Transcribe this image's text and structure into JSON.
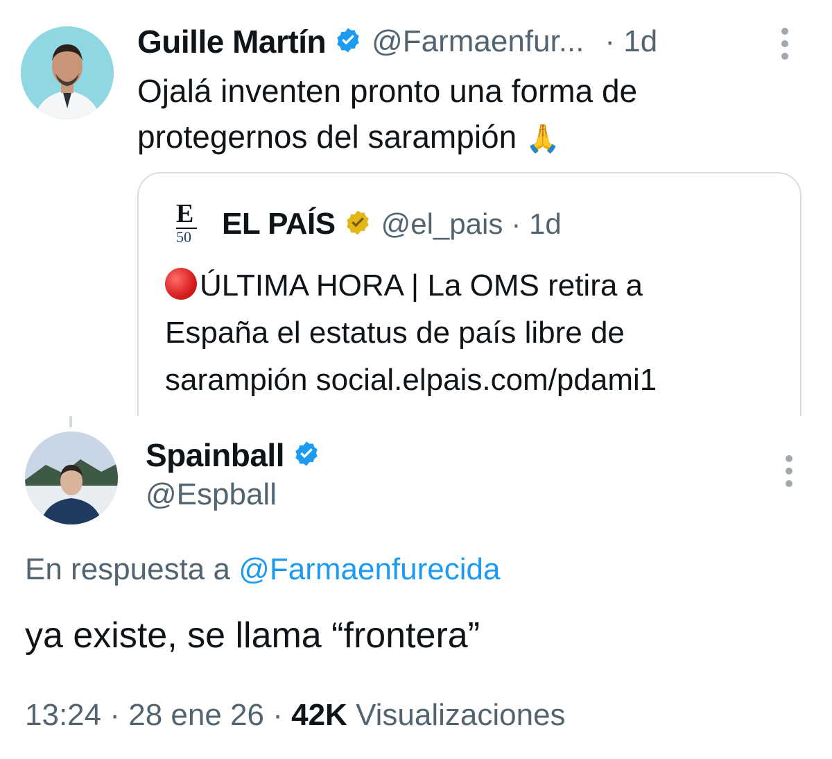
{
  "tweet1": {
    "name": "Guille Martín",
    "handle": "@Farmaenfur...",
    "time": "· 1d",
    "text_line1": "Ojalá inventen pronto una forma de",
    "text_line2": "protegernos del sarampión",
    "emoji": "🙏",
    "verified_badge_color": "#1d9bf0"
  },
  "quote": {
    "logo_letter": "E",
    "logo_number": "50",
    "name": "EL PAÍS",
    "handle": "@el_pais",
    "time": "· 1d",
    "badge_color": "#e2b719",
    "text_line1": "ÚLTIMA HORA | La OMS retira a",
    "text_line2": "España el estatus de país libre de",
    "text_line3": "sarampión social.elpais.com/pdami1"
  },
  "tweet2": {
    "name": "Spainball",
    "handle": "@Espball",
    "reply_prefix": "En respuesta a",
    "reply_mention": "@Farmaenfurecida",
    "text": "ya existe, se llama “frontera”",
    "time": "13:24",
    "date": "28 ene 26",
    "views_count": "42K",
    "views_label": "Visualizaciones",
    "verified_badge_color": "#1d9bf0"
  },
  "colors": {
    "link": "#1d9bf0",
    "secondary_text": "#536471",
    "border": "#d7dde2"
  }
}
